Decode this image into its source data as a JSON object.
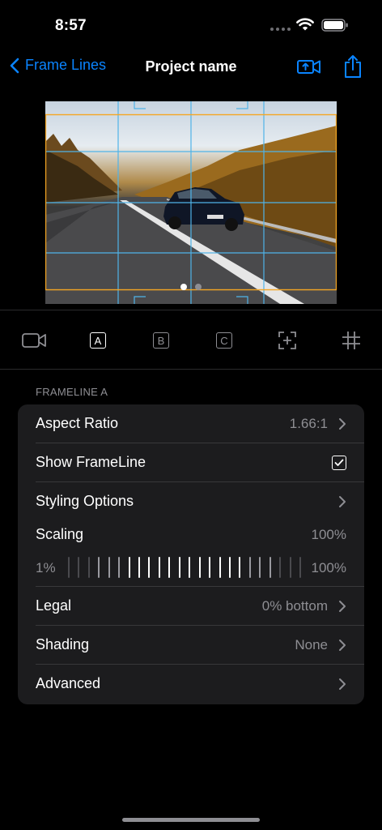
{
  "status": {
    "time": "8:57"
  },
  "nav": {
    "back_label": "Frame Lines",
    "title": "Project name"
  },
  "preview": {
    "page_count": 2,
    "active_page": 1
  },
  "tools": [
    {
      "name": "camera-icon",
      "letter": ""
    },
    {
      "name": "frameline-a-button",
      "letter": "A",
      "active": true
    },
    {
      "name": "frameline-b-button",
      "letter": "B",
      "active": false
    },
    {
      "name": "frameline-c-button",
      "letter": "C",
      "active": false
    },
    {
      "name": "center-marker-icon",
      "letter": ""
    },
    {
      "name": "grid-icon",
      "letter": ""
    }
  ],
  "section": {
    "header": "FRAMELINE A",
    "rows": {
      "aspect_ratio": {
        "label": "Aspect Ratio",
        "value": "1.66:1"
      },
      "show_frameline": {
        "label": "Show FrameLine",
        "checked": true
      },
      "styling": {
        "label": "Styling Options"
      },
      "legal": {
        "label": "Legal",
        "value": "0% bottom"
      },
      "shading": {
        "label": "Shading",
        "value": "None"
      },
      "advanced": {
        "label": "Advanced"
      }
    },
    "scaling": {
      "label": "Scaling",
      "value": "100%",
      "min_label": "1%",
      "max_label": "100%",
      "level": 1.0
    }
  },
  "colors": {
    "accent": "#0a84ff",
    "frameline": "#f5a623",
    "grid": "#4fb3e8"
  }
}
